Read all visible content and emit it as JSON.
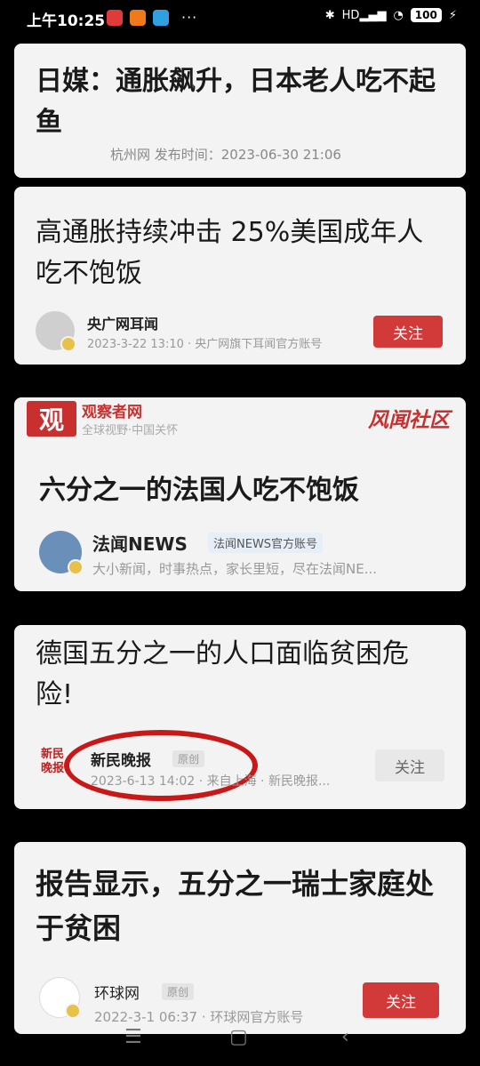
{
  "status_bar": {
    "time": "上午10:25",
    "dots": "···",
    "network": "HD",
    "battery": "100"
  },
  "cards": [
    {
      "title": "日媒：通胀飙升，日本老人吃不起鱼",
      "meta": "杭州网  发布时间：2023-06-30 21:06"
    },
    {
      "title": "高通胀持续冲击 25%美国成年人吃不饱饭",
      "source": "央广网耳闻",
      "sub": "2023-3-22 13:10 · 央广网旗下耳闻官方账号",
      "follow": "关注"
    },
    {
      "brand": "观察者网",
      "brand_sub": "全球视野·中国关怀",
      "brand_logo": "观",
      "brand_right": "风闻社区",
      "title": "六分之一的法国人吃不饱饭",
      "source": "法闻NEWS",
      "verified": "法闻NEWS官方账号",
      "sub": "大小新闻，时事热点，家长里短，尽在法闻NE..."
    },
    {
      "title": "德国五分之一的人口面临贫困危险!",
      "source": "新民晚报",
      "orig": "原创",
      "sub": "2023-6-13 14:02 · 来自上海 · 新民晚报...",
      "follow": "关注",
      "logo": "新民晚报"
    },
    {
      "title": "报告显示，五分之一瑞士家庭处于贫困",
      "source": "环球网",
      "orig": "原创",
      "sub": "2022-3-1 06:37 · 环球网官方账号",
      "follow": "关注"
    }
  ],
  "nav": {
    "menu": "☰",
    "home": "▢",
    "back": "‹"
  }
}
